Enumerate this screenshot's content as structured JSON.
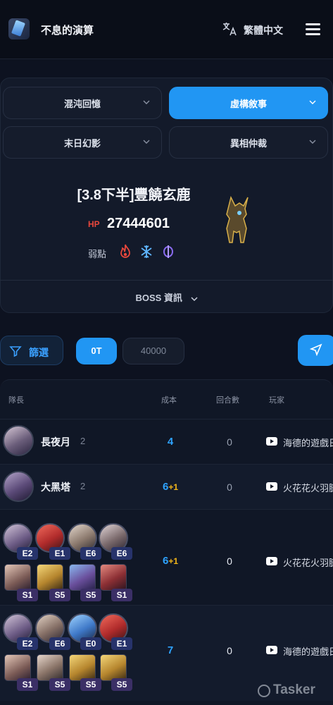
{
  "header": {
    "app_title": "不息的演算",
    "lang_label": "繁體中文",
    "icons": [
      "app-logo",
      "translate-icon",
      "menu-icon"
    ]
  },
  "modes": [
    {
      "label": "混沌回憶",
      "active": false
    },
    {
      "label": "虛構敘事",
      "active": true
    },
    {
      "label": "末日幻影",
      "active": false
    },
    {
      "label": "異相仲裁",
      "active": false
    }
  ],
  "boss": {
    "name": "[3.8下半]豐饒玄鹿",
    "hp_label": "HP",
    "hp_value": "27444601",
    "weakness_label": "弱點",
    "weaknesses": [
      "fire-icon",
      "ice-icon",
      "imaginary-icon"
    ],
    "info_label": "BOSS 資訊"
  },
  "filters": {
    "filter_label": "篩選",
    "turn_pill": "0T",
    "cost_value": "40000"
  },
  "table": {
    "headers": {
      "leader": "隊長",
      "cost": "成本",
      "turns": "回合數",
      "player": "玩家"
    },
    "rows": [
      {
        "leader": "長夜月",
        "count": "2",
        "cost": "4",
        "cost_plus": "",
        "turns": "0",
        "player": "海德的遊戲日"
      },
      {
        "leader": "大黑塔",
        "count": "2",
        "cost": "6",
        "cost_plus": "+1",
        "turns": "0",
        "player": "火花花火羽腿"
      },
      {
        "cost": "6",
        "cost_plus": "+1",
        "turns": "0",
        "player": "火花花火羽腿",
        "eidolons": [
          "E2",
          "E1",
          "E6",
          "E6"
        ],
        "superimpositions": [
          "S1",
          "S5",
          "S5",
          "S1"
        ]
      },
      {
        "cost": "7",
        "cost_plus": "",
        "turns": "0",
        "player": "海德的遊戲日",
        "eidolons": [
          "E2",
          "E6",
          "E0",
          "E1"
        ],
        "superimpositions": [
          "S1",
          "S5",
          "S5",
          "S5"
        ]
      }
    ]
  },
  "watermark": "Tasker",
  "colors": {
    "accent": "#2196f3",
    "bg": "#0d1220",
    "fire": "#e8473c",
    "gold": "#f2b619"
  }
}
